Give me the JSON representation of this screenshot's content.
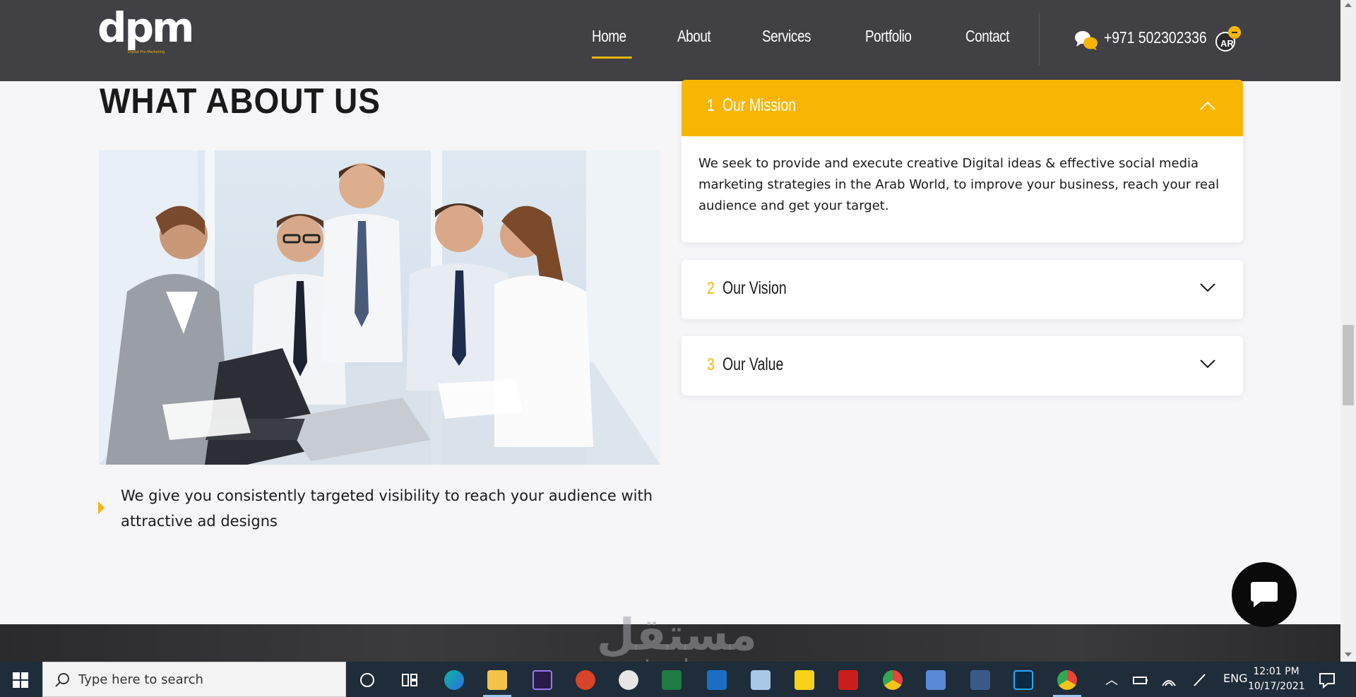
{
  "header": {
    "logo_text": "dpm",
    "logo_tagline": "Digital Pro Marketing",
    "nav": [
      {
        "label": "Home",
        "active": true
      },
      {
        "label": "About"
      },
      {
        "label": "Services"
      },
      {
        "label": "Portfolio"
      },
      {
        "label": "Contact"
      }
    ],
    "phone": "+971 502302336",
    "language": "AR"
  },
  "about": {
    "title": "WHAT ABOUT US",
    "bullet_text": "We give you consistently targeted visibility to reach your audience with attractive ad designs"
  },
  "accordion": [
    {
      "num": "1",
      "label": "Our Mission",
      "open": true,
      "body": "We seek to provide and execute creative Digital ideas & effective social media marketing strategies in the Arab World, to improve your business, reach your real audience and get your target."
    },
    {
      "num": "2",
      "label": "Our Vision",
      "open": false
    },
    {
      "num": "3",
      "label": "Our Value",
      "open": false
    }
  ],
  "watermark": {
    "arabic": "مستقل",
    "latin": "mostaql.com"
  },
  "taskbar": {
    "search_placeholder": "Type here to search",
    "language": "ENG",
    "time": "12:01 PM",
    "date": "10/17/2021"
  },
  "colors": {
    "accent": "#f8b502",
    "header_bg": "#414045",
    "page_bg": "#f6f6f9",
    "taskbar_bg": "#1f2c3a"
  }
}
